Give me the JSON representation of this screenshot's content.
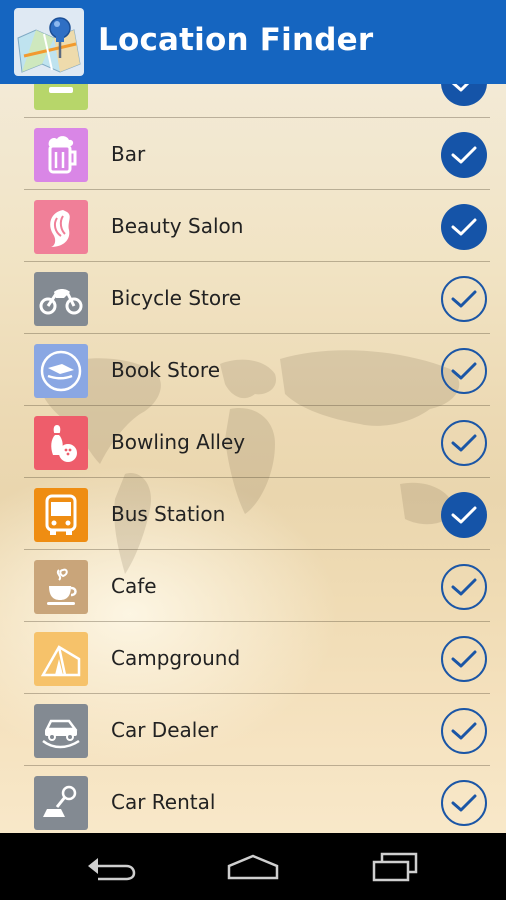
{
  "app": {
    "title": "Location Finder",
    "accent_color": "#1565c0",
    "check_color": "#1554a8"
  },
  "list": {
    "items": [
      {
        "label": "",
        "icon": "partial-icon",
        "icon_bg": "#b7d66a",
        "checked": true
      },
      {
        "label": "Bar",
        "icon": "beer-mug-icon",
        "icon_bg": "#d986e6",
        "checked": true
      },
      {
        "label": "Beauty Salon",
        "icon": "woman-hair-icon",
        "icon_bg": "#f07f98",
        "checked": true
      },
      {
        "label": "Bicycle Store",
        "icon": "motorcycle-icon",
        "icon_bg": "#838a92",
        "checked": false
      },
      {
        "label": "Book Store",
        "icon": "book-in-hand-icon",
        "icon_bg": "#8aa7e3",
        "checked": false
      },
      {
        "label": "Bowling Alley",
        "icon": "bowling-pin-icon",
        "icon_bg": "#ee5d6b",
        "checked": false
      },
      {
        "label": "Bus Station",
        "icon": "bus-icon",
        "icon_bg": "#ef8d12",
        "checked": true
      },
      {
        "label": "Cafe",
        "icon": "coffee-cup-icon",
        "icon_bg": "#c9a57a",
        "checked": false
      },
      {
        "label": "Campground",
        "icon": "tent-icon",
        "icon_bg": "#f6c26a",
        "checked": false
      },
      {
        "label": "Car Dealer",
        "icon": "car-in-hand-icon",
        "icon_bg": "#838a92",
        "checked": false
      },
      {
        "label": "Car Rental",
        "icon": "car-key-icon",
        "icon_bg": "#838a92",
        "checked": false
      }
    ]
  },
  "navbar": {
    "back": "back-icon",
    "home": "home-icon",
    "recents": "recents-icon"
  }
}
